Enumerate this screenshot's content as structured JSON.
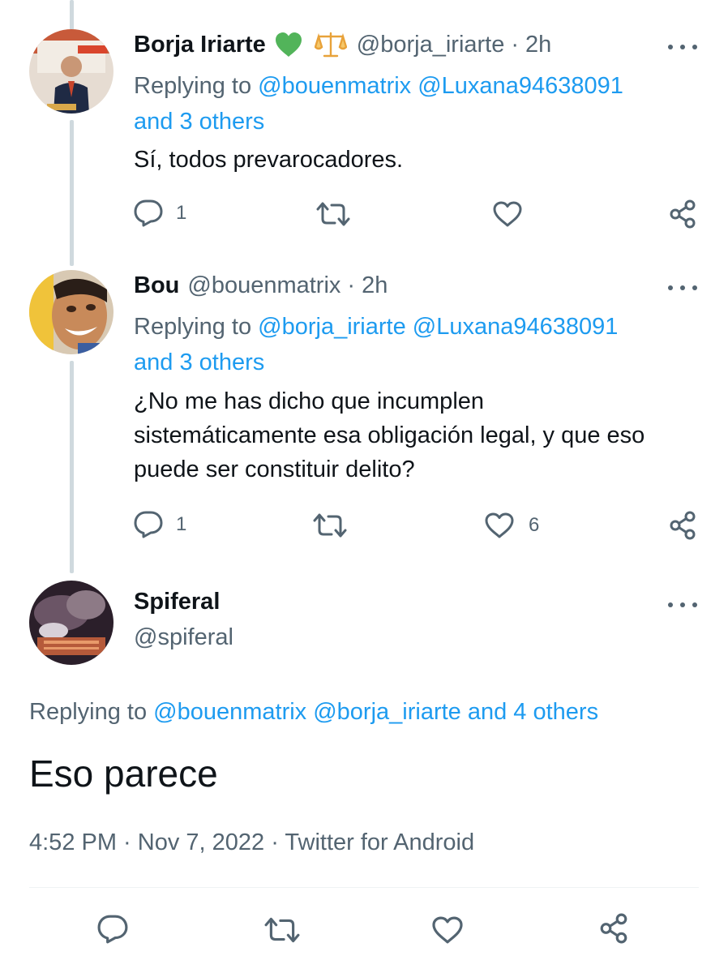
{
  "tweets": [
    {
      "name": "Borja Iriarte",
      "name_emoji": "💚",
      "badge_emoji": "⚖️",
      "handle": "@borja_iriarte",
      "time": "2h",
      "replying_prefix": "Replying to",
      "reply_mentions": "@bouenmatrix @Luxana94638091",
      "reply_others": "and 3 others",
      "text": "Sí, todos prevarocadores.",
      "reply_count": "1",
      "like_count": ""
    },
    {
      "name": "Bou",
      "handle": "@bouenmatrix",
      "time": "2h",
      "replying_prefix": "Replying to",
      "reply_mentions": "@borja_iriarte @Luxana94638091",
      "reply_others": "and 3 others",
      "text_lines": [
        "¿No me has dicho que incumplen",
        "sistemáticamente esa obligación legal, y que eso",
        "puede ser constituir delito?"
      ],
      "reply_count": "1",
      "like_count": "6"
    }
  ],
  "main_tweet": {
    "name": "Spiferal",
    "handle": "@spiferal",
    "replying_prefix": "Replying to",
    "reply_mentions": "@bouenmatrix @borja_iriarte and 4 others",
    "text": "Eso parece",
    "timestamp": "4:52 PM · Nov 7, 2022 · Twitter for Android"
  },
  "icons": [
    "reply-icon",
    "retweet-icon",
    "like-icon",
    "share-icon",
    "more-icon"
  ],
  "colors": {
    "link": "#1d9bf0",
    "muted": "#536471",
    "text": "#0f1419",
    "heart": "#4caf50"
  }
}
